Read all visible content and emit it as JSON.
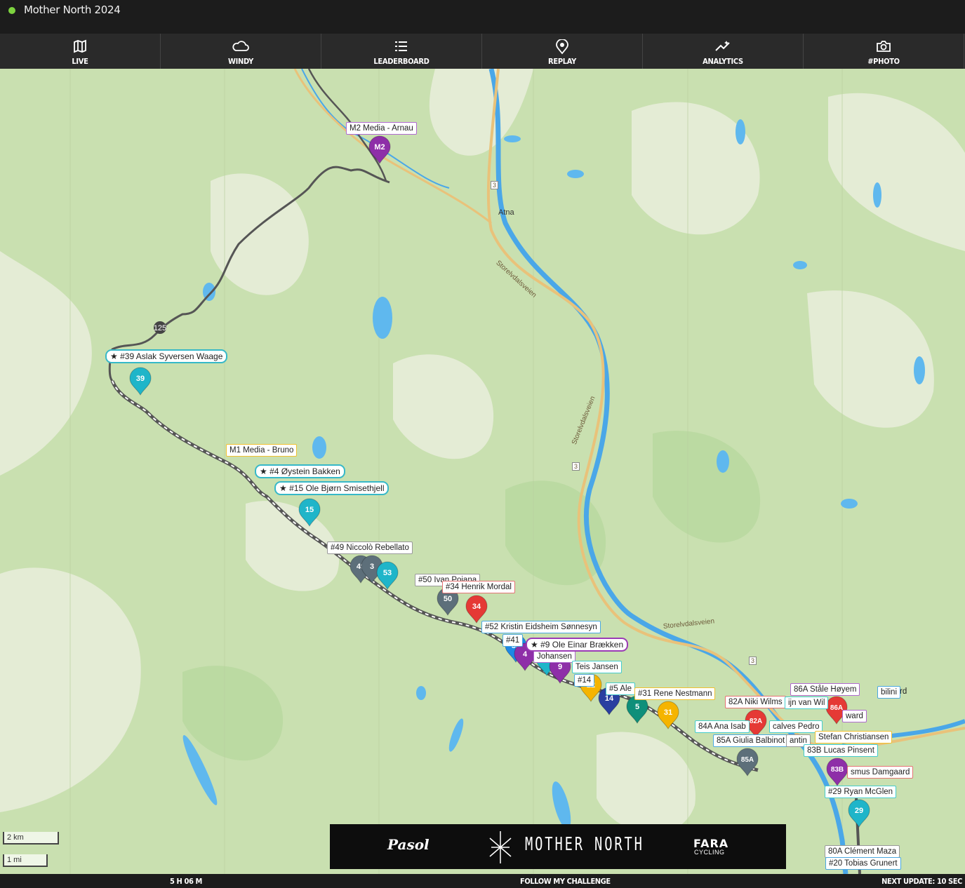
{
  "header": {
    "title": "Mother North 2024",
    "live_color": "#7dd33f"
  },
  "nav": [
    {
      "label": "LIVE",
      "icon": "map-icon"
    },
    {
      "label": "WINDY",
      "icon": "cloud-icon"
    },
    {
      "label": "LEADERBOARD",
      "icon": "list-icon"
    },
    {
      "label": "REPLAY",
      "icon": "replay-pin-icon"
    },
    {
      "label": "ANALYTICS",
      "icon": "analytics-icon"
    },
    {
      "label": "#PHOTO",
      "icon": "camera-icon"
    }
  ],
  "map": {
    "towns": [
      "Atna"
    ],
    "roads": [
      "Storelvdalsveien",
      "Storelvdalsveien",
      "Storelvdalsveien"
    ],
    "road_numbers": [
      "3",
      "3",
      "3"
    ],
    "route_marker": "125",
    "scale": {
      "km": "2 km",
      "mi": "1 mi"
    },
    "labels": [
      "M2 Media - Arnau",
      "#39 Aslak Syversen Waage",
      "M1 Media - Bruno",
      "#4 Øystein Bakken",
      "#15 Ole Bjørn Smisethjell",
      "#49 Niccolò Rebellato",
      "#50 Ivan Pojana",
      "#34 Henrik Mordal",
      "#52 Kristin Eidsheim Sønnesyn",
      "#9 Ole Einar Brækken",
      "Teis Jansen",
      "#31 Rene Nestmann",
      "86A Ståle Høyem",
      "82A Niki Wilms",
      "84A Ana Isab",
      "calves Pedro",
      "85A Giulia Balbinot",
      "Stefan Christiansen",
      "83B Lucas Pinsent",
      "smus Damgaard",
      "#29 Ryan McGlen",
      "80A Clément Maza",
      "#20 Tobias Grunert",
      "#14",
      "#41",
      "#5 Ale",
      "ijn van Wil",
      "ward",
      "Johansen",
      "antin",
      "bilini",
      "rd"
    ],
    "pins": [
      {
        "id": "M2",
        "color": "#8e2fa8"
      },
      {
        "id": "39",
        "color": "#1fb5c9"
      },
      {
        "id": "15",
        "color": "#1fb5c9"
      },
      {
        "id": "49",
        "color": "#5d6f7a"
      },
      {
        "id": "3",
        "color": "#5d6f7a"
      },
      {
        "id": "53",
        "color": "#1fb5c9"
      },
      {
        "id": "50",
        "color": "#5d6f7a"
      },
      {
        "id": "34",
        "color": "#e53935"
      },
      {
        "id": "52",
        "color": "#1e88e5"
      },
      {
        "id": "4",
        "color": "#8e2fa8"
      },
      {
        "id": "54",
        "color": "#1fb5c9"
      },
      {
        "id": "9",
        "color": "#8e2fa8"
      },
      {
        "id": "22",
        "color": "#f5b400"
      },
      {
        "id": "14",
        "color": "#2a3fa0"
      },
      {
        "id": "5",
        "color": "#0f8f7a"
      },
      {
        "id": "31",
        "color": "#f5b400"
      },
      {
        "id": "82A",
        "color": "#e53935"
      },
      {
        "id": "86A",
        "color": "#e53935"
      },
      {
        "id": "85A",
        "color": "#5d6f7a"
      },
      {
        "id": "83B",
        "color": "#8e2fa8"
      },
      {
        "id": "29",
        "color": "#1fb5c9"
      }
    ]
  },
  "sponsors": {
    "left": "Pasol",
    "center": "MOTHER NORTH",
    "right": "FARA",
    "right_sub": "CYCLING"
  },
  "footer": {
    "timer": "5 H 06 M",
    "follow": "FOLLOW MY CHALLENGE",
    "next_update": "NEXT UPDATE: 10 SEC"
  }
}
